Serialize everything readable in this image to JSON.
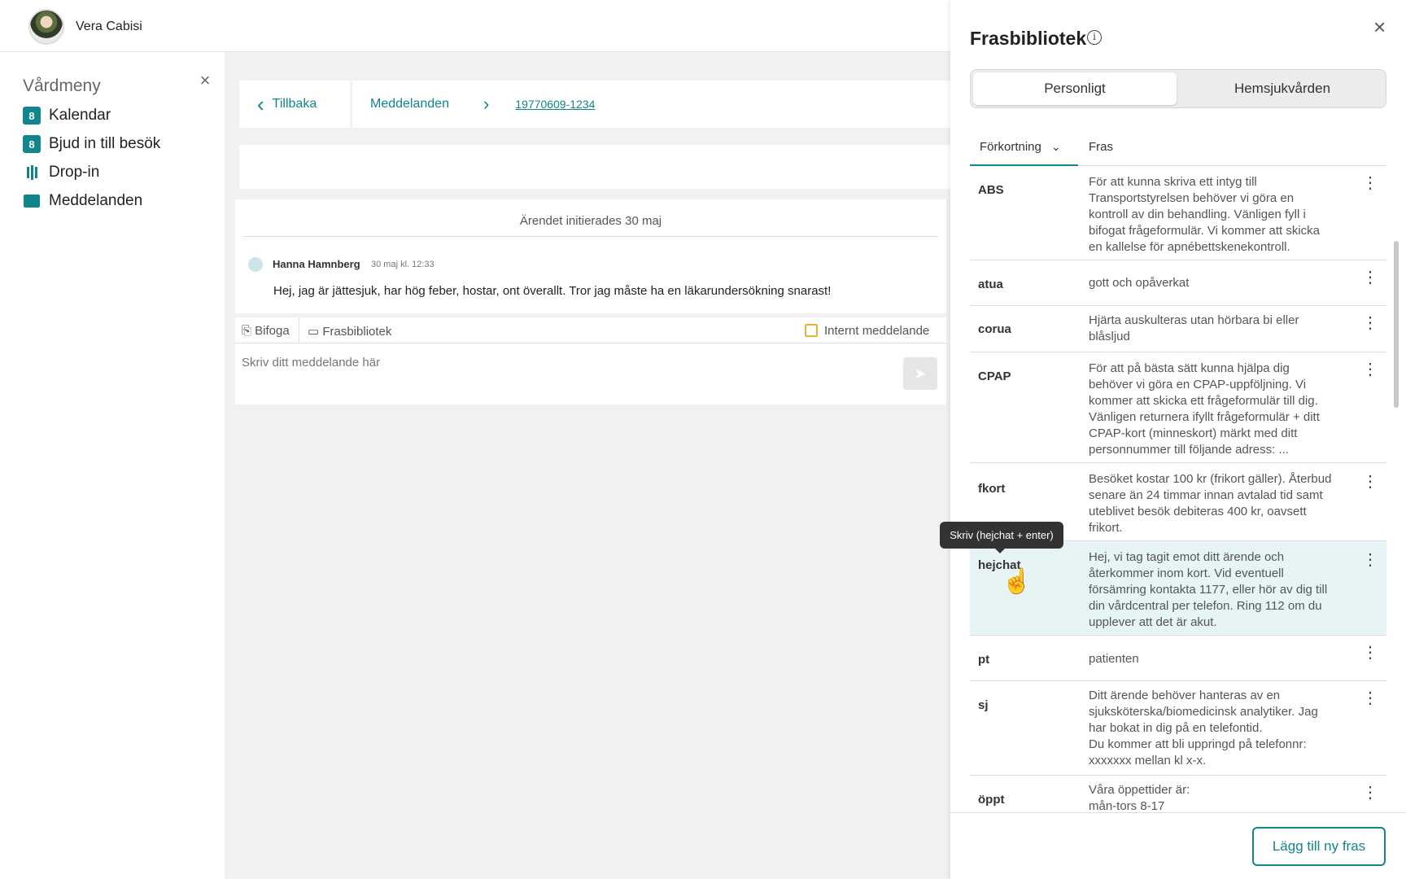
{
  "user": {
    "name": "Vera Cabisi"
  },
  "sidebar": {
    "title": "Vårdmeny",
    "close_icon": "×",
    "items": [
      {
        "label": "Kalendar",
        "icon": "calendar-icon",
        "glyph": "8"
      },
      {
        "label": "Bjud in till besök",
        "icon": "calendar-invite-icon",
        "glyph": "8"
      },
      {
        "label": "Drop-in",
        "icon": "queue-icon"
      },
      {
        "label": "Meddelanden",
        "icon": "message-icon"
      }
    ]
  },
  "breadcrumb": {
    "back": "Tillbaka",
    "back_glyph": "‹",
    "section": "Meddelanden",
    "separator": "›",
    "current": "19770609-1234"
  },
  "conversation": {
    "initiated": "Ärendet initierades 30 maj",
    "message": {
      "author": "Hanna Hamnberg",
      "time": "30 maj kl. 12:33",
      "text": "Hej, jag är jättesjuk, har hög feber, hostar, ont överallt. Tror jag måste ha en läkarundersökning snarast!"
    }
  },
  "composer": {
    "attach_label": "⎘ Bifoga",
    "phrase_label": "▭ Frasbibliotek",
    "internal_label": "Internt meddelande",
    "placeholder": "Skriv ditt meddelande här",
    "send_glyph": "➤"
  },
  "phrase_panel": {
    "title": "Frasbibliotek",
    "info_glyph": "i",
    "close_glyph": "×",
    "tabs": [
      {
        "label": "Personligt",
        "active": true
      },
      {
        "label": "Hemsjukvården",
        "active": false
      }
    ],
    "columns": {
      "abbr": "Förkortning",
      "sort_glyph": "⌄",
      "phrase": "Fras"
    },
    "more_glyph": "⋮",
    "rows": [
      {
        "abbr": "ABS",
        "phrase": "För att kunna skriva ett intyg till Transportstyrelsen behöver vi göra en kontroll av din behandling. Vänligen fyll i bifogat frågeformulär. Vi kommer att skicka en kallelse för apnébettskenekontroll."
      },
      {
        "abbr": "atua",
        "phrase": "gott och opåverkat"
      },
      {
        "abbr": "corua",
        "phrase": "Hjärta auskulteras utan hörbara bi eller blåsljud"
      },
      {
        "abbr": "CPAP",
        "phrase": "För att på bästa sätt kunna hjälpa dig behöver vi göra en CPAP-uppföljning. Vi kommer att skicka ett frågeformulär till dig. Vänligen returnera ifyllt frågeformulär + ditt CPAP-kort (minneskort) märkt med ditt personnummer till följande adress: ..."
      },
      {
        "abbr": "fkort",
        "phrase": "Besöket kostar 100 kr (frikort gäller). Återbud senare än 24 timmar innan avtalad tid samt uteblivet besök debiteras 400 kr, oavsett frikort."
      },
      {
        "abbr": "hejchat",
        "phrase": "Hej, vi tag tagit emot ditt ärende och återkommer inom kort. Vid eventuell försämring kontakta 1177, eller hör av dig till din vårdcentral per telefon. Ring 112 om du upplever att det är akut.",
        "highlighted": true
      },
      {
        "abbr": "pt",
        "phrase": "patienten"
      },
      {
        "abbr": "sj",
        "phrase": "Ditt ärende behöver hanteras av en sjuksköterska/biomedicinsk analytiker. Jag har bokat in dig på en telefontid.\nDu kommer att bli uppringd på telefonnr: xxxxxxx mellan kl x-x."
      },
      {
        "abbr": "öppt",
        "phrase": "Våra öppettider är:\nmån-tors 8-17"
      }
    ],
    "tooltip": "Skriv (hejchat + enter)",
    "cursor_glyph": "☝",
    "add_button": "Lägg till ny fras"
  },
  "colors": {
    "accent": "#12848c",
    "highlight": "#e7f4f5",
    "checkbox": "#e8b33a"
  }
}
